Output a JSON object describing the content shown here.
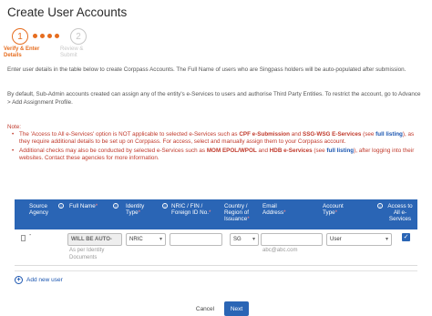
{
  "page": {
    "title": "Create User Accounts"
  },
  "stepper": {
    "step1_number": "1",
    "step1_label": "Verify & Enter Details",
    "step2_number": "2",
    "step2_label": "Review & Submit"
  },
  "intro": {
    "p1": "Enter user details in the table below to create Corppass Accounts. The Full Name of users who are Singpass holders will be auto-populated after submission.",
    "p2": "By default, Sub-Admin accounts created can assign any of the entity's e-Services to users and authorise Third Party Entities. To restrict the account, go to Advance > Add Assignment Profile."
  },
  "notes": {
    "label": "Note:",
    "n1_a": "The 'Access to All e-Services' option is NOT applicable to selected e-Services such as ",
    "n1_b": "CPF e-Submission",
    "n1_c": " and ",
    "n1_d": "SSG-WSG E-Services",
    "n1_e": " (see ",
    "n1_f": "full listing",
    "n1_g": "), as they require additional details to be set up on Corppass. For access, select and manually assign them to your Corppass account.",
    "n2_a": "Additional checks may also be conducted by selected e-Services  such as ",
    "n2_b": "MOM EPOL/WPOL",
    "n2_c": " and ",
    "n2_d": "HDB e-Services",
    "n2_e": " (see ",
    "n2_f": "full listing",
    "n2_g": "), after logging into their websites. Contact these agencies for more information."
  },
  "table": {
    "headers": {
      "source_agency": "Source Agency",
      "full_name": "Full Name",
      "identity_type": "Identity Type",
      "nric": "NRIC / FIN / Foreign ID No.",
      "country": "Country / Region of Issuance",
      "email": "Email Address",
      "account_type": "Account Type",
      "access_all": "Access to All e-Services"
    },
    "row": {
      "source_dash": "-",
      "full_name_value": "WILL BE AUTO-",
      "full_name_helper": "As per Identity Documents",
      "identity_type_value": "NRIC",
      "nric_value": "",
      "country_value": "SG",
      "email_value": "",
      "email_helper": "abc@abc.com",
      "account_type_value": "User",
      "access_all_checked": "✓"
    }
  },
  "actions": {
    "add_user": "Add new user",
    "cancel": "Cancel",
    "next": "Next"
  },
  "colors": {
    "primary": "#2a65b5",
    "step_active": "#e66d1f",
    "note_red": "#c0392b"
  }
}
